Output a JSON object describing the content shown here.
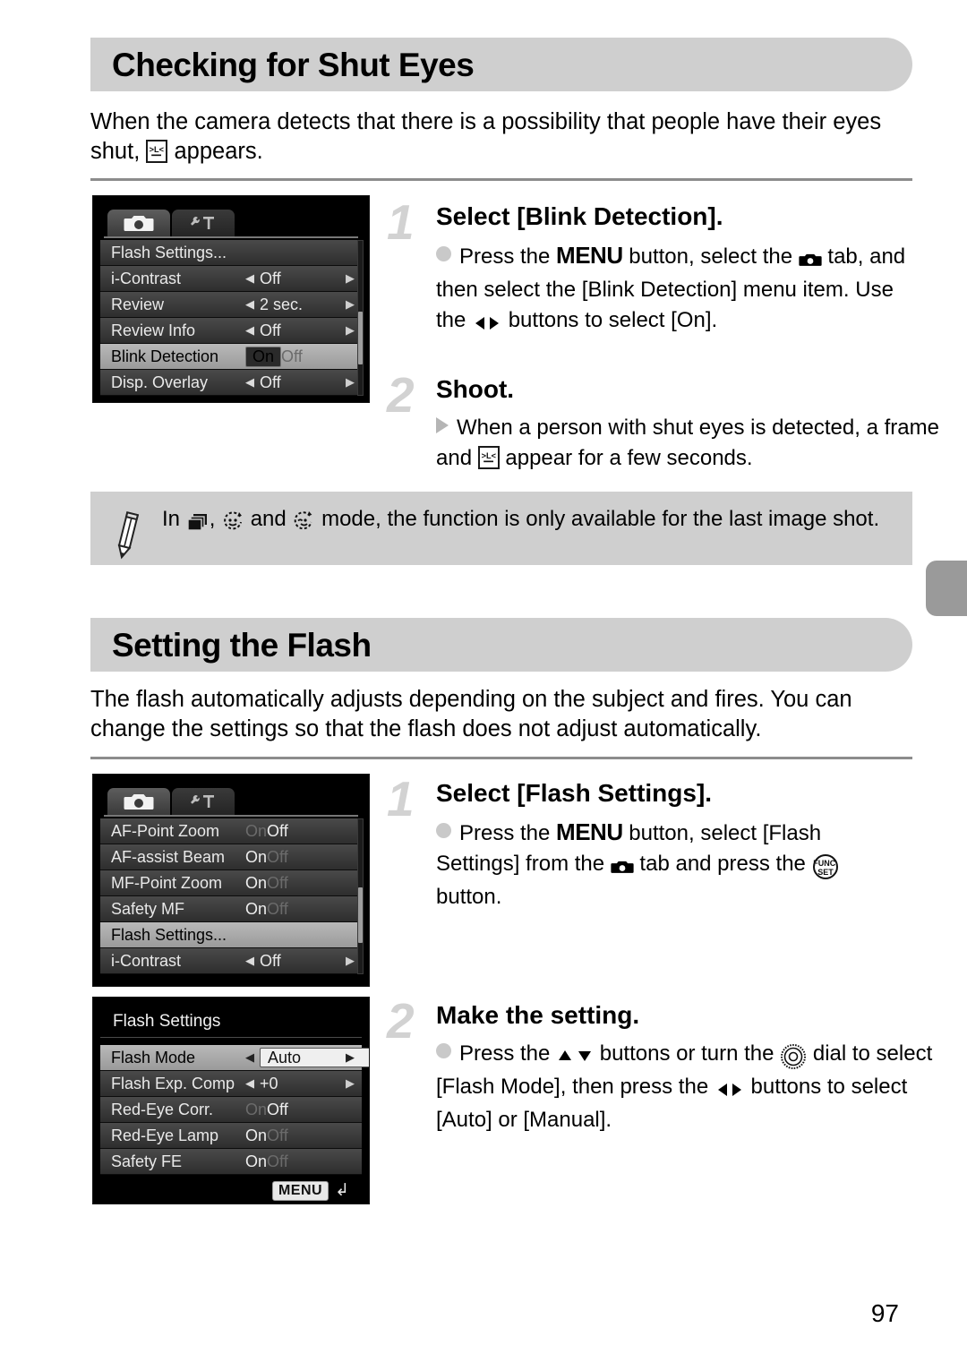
{
  "page": {
    "number": "97"
  },
  "sections": [
    {
      "id": "blink",
      "title": "Checking for Shut Eyes",
      "intro_before": "When the camera detects that there is a possibility that people have their eyes shut,",
      "intro_after": "appears.",
      "steps": [
        {
          "num": "1",
          "title": "Select [Blink Detection].",
          "body_parts": [
            "Press the ",
            "MENU",
            " button, select the ",
            " tab, and then select the [Blink Detection] menu item. Use the ",
            " buttons to select [On]."
          ]
        },
        {
          "num": "2",
          "title": "Shoot.",
          "body_parts": [
            "When a person with shut eyes is detected, a frame and ",
            " appear for a few seconds."
          ]
        }
      ],
      "note": {
        "before": "In",
        "mid1": ",",
        "mid2": "and",
        "after": "mode, the function is only available for the last image shot.",
        "icons": [
          "continuous-shooting-icon",
          "face-self-timer-icon",
          "wink-self-timer-icon"
        ]
      },
      "screen": {
        "name": "shooting-menu-blink-detection",
        "tabs": [
          "camera-tab",
          "settings-tab"
        ],
        "rows": [
          {
            "label": "Flash Settings...",
            "kind": "link",
            "value": "",
            "selected": false
          },
          {
            "label": "i-Contrast",
            "kind": "spin",
            "value": "Off",
            "selected": false
          },
          {
            "label": "Review",
            "kind": "spin",
            "value": "2 sec.",
            "selected": false
          },
          {
            "label": "Review Info",
            "kind": "spin",
            "value": "Off",
            "selected": false
          },
          {
            "label": "Blink Detection",
            "kind": "onoff",
            "on": "On",
            "off": "Off",
            "active": "On",
            "selected": true
          },
          {
            "label": "Disp. Overlay",
            "kind": "spin",
            "value": "Off",
            "selected": false
          }
        ],
        "scroll": {
          "top_pct": 46,
          "height_pct": 34
        }
      }
    },
    {
      "id": "flash",
      "title": "Setting the Flash",
      "intro": "The flash automatically adjusts depending on the subject and fires. You can change the settings so that the flash does not adjust automatically.",
      "steps": [
        {
          "num": "1",
          "title": "Select [Flash Settings].",
          "body_parts": [
            "Press the ",
            "MENU",
            " button, select [Flash Settings] from the ",
            " tab and press the ",
            " button."
          ]
        },
        {
          "num": "2",
          "title": "Make the setting.",
          "body_parts": [
            "Press the ",
            " buttons or turn the ",
            " dial to select [Flash Mode], then press the ",
            " buttons to select [Auto] or [Manual]."
          ]
        }
      ],
      "screen_menu": {
        "name": "shooting-menu-flash-settings",
        "tabs": [
          "camera-tab",
          "settings-tab"
        ],
        "rows": [
          {
            "label": "AF-Point Zoom",
            "kind": "onoff",
            "on": "On",
            "off": "Off",
            "active": "Off",
            "selected": false
          },
          {
            "label": "AF-assist Beam",
            "kind": "onoff",
            "on": "On",
            "off": "Off",
            "active": "On",
            "selected": false
          },
          {
            "label": "MF-Point Zoom",
            "kind": "onoff",
            "on": "On",
            "off": "Off",
            "active": "On",
            "selected": false
          },
          {
            "label": "Safety MF",
            "kind": "onoff",
            "on": "On",
            "off": "Off",
            "active": "On",
            "selected": false
          },
          {
            "label": "Flash Settings...",
            "kind": "link",
            "value": "",
            "selected": true
          },
          {
            "label": "i-Contrast",
            "kind": "spin",
            "value": "Off",
            "selected": false
          }
        ],
        "scroll": {
          "top_pct": 44,
          "height_pct": 36
        }
      },
      "screen_dialog": {
        "name": "flash-settings-dialog",
        "title": "Flash Settings",
        "rows": [
          {
            "label": "Flash Mode",
            "kind": "box",
            "value": "Auto",
            "selected": true
          },
          {
            "label": "Flash Exp. Comp",
            "kind": "spin",
            "value": "+0",
            "selected": false
          },
          {
            "label": "Red-Eye Corr.",
            "kind": "onoff",
            "on": "On",
            "off": "Off",
            "active": "Off",
            "selected": false
          },
          {
            "label": "Red-Eye Lamp",
            "kind": "onoff",
            "on": "On",
            "off": "Off",
            "active": "On",
            "selected": false
          },
          {
            "label": "Safety FE",
            "kind": "onoff",
            "on": "On",
            "off": "Off",
            "active": "On",
            "selected": false
          }
        ],
        "footer": {
          "badge": "MENU",
          "back_glyph": "back-arrow-icon"
        }
      }
    }
  ],
  "colors": {
    "header_bar": "#cfcfcf",
    "note_bar": "#cfcfcf",
    "step_number": "#d2d2d2",
    "rule": "#8c8c8c",
    "edge_tab": "#9a9a9a"
  }
}
